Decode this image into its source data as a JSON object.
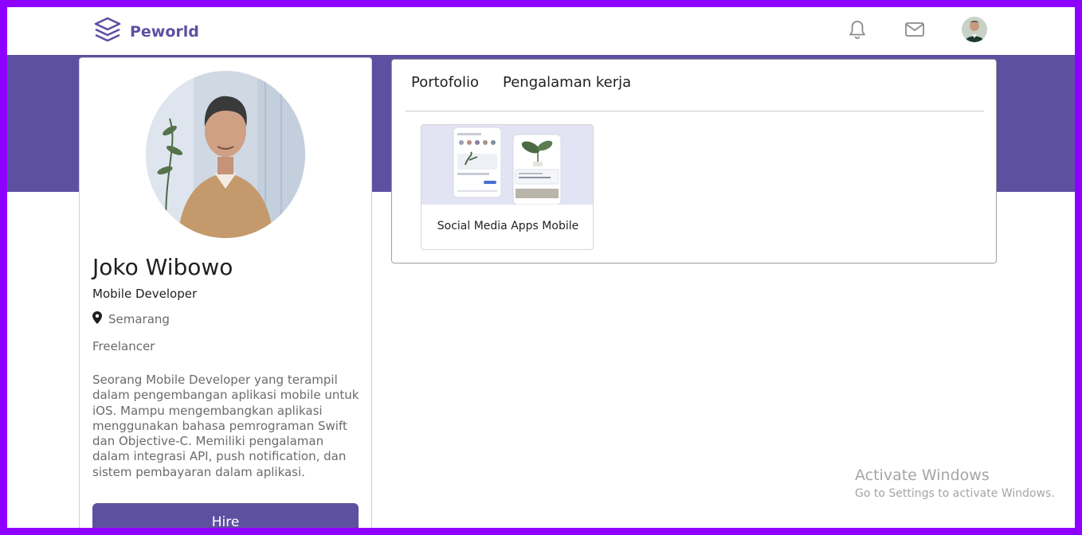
{
  "app": {
    "brand_name": "Peworld",
    "brand_color": "#5e50a1"
  },
  "navbar": {
    "icons": [
      "bell-icon",
      "mail-icon"
    ],
    "avatar": "user-avatar"
  },
  "profile": {
    "name": "Joko Wibowo",
    "role": "Mobile Developer",
    "location": "Semarang",
    "status": "Freelancer",
    "description": "Seorang Mobile Developer yang terampil dalam pengembangan aplikasi mobile untuk iOS. Mampu mengembangkan aplikasi menggunakan bahasa pemrograman Swift dan Objective-C. Memiliki pengalaman dalam integrasi API, push notification, dan sistem pembayaran dalam aplikasi.",
    "hire_label": "Hire"
  },
  "tabs": [
    {
      "label": "Portofolio"
    },
    {
      "label": "Pengalaman kerja"
    }
  ],
  "portfolio": [
    {
      "title": "Social Media Apps Mobile"
    }
  ],
  "watermark": {
    "title": "Activate Windows",
    "subtitle": "Go to Settings to activate Windows."
  },
  "colors": {
    "accent": "#5e50a1",
    "frame": "#8e00ff"
  }
}
